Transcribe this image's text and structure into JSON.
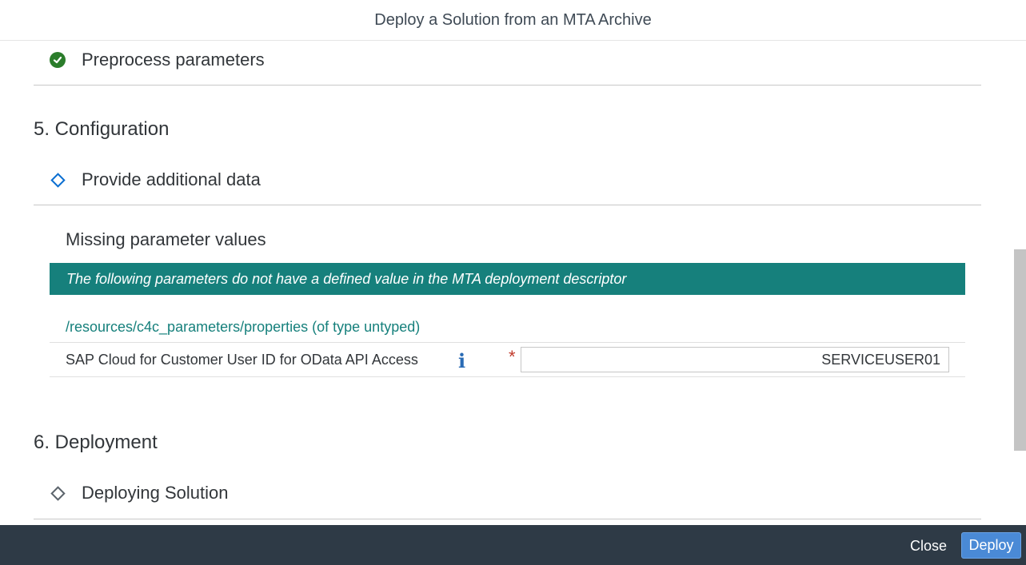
{
  "dialog": {
    "title": "Deploy a Solution from an MTA Archive"
  },
  "steps": {
    "preprocess": {
      "label": "Preprocess parameters",
      "icon": "check-circle-icon",
      "status": "done"
    },
    "section5": {
      "title": "5. Configuration"
    },
    "provide_data": {
      "label": "Provide additional data",
      "icon": "diamond-icon",
      "status": "current"
    },
    "section6": {
      "title": "6. Deployment"
    },
    "deploying": {
      "label": "Deploying Solution",
      "icon": "diamond-icon",
      "status": "pending"
    }
  },
  "missing_params": {
    "heading": "Missing parameter values",
    "banner": "The following parameters do not have a defined value in the MTA deployment descriptor",
    "resource_path": "/resources/c4c_parameters/properties (of type untyped)",
    "fields": [
      {
        "label": "SAP Cloud for Customer User ID for OData API Access",
        "info_icon": "i",
        "required_marker": "*",
        "value": "SERVICEUSER01"
      }
    ]
  },
  "footer": {
    "close_label": "Close",
    "deploy_label": "Deploy"
  },
  "colors": {
    "accent_teal": "#16807c",
    "success_green": "#2b7d2b",
    "footer_bg": "#2e3a46",
    "deploy_button": "#4a8ad6"
  }
}
